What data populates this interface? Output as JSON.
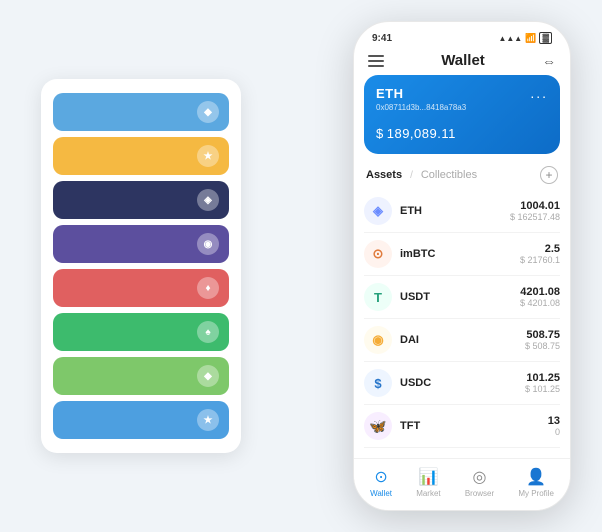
{
  "scene": {
    "background_color": "#f0f4f8"
  },
  "card_stack": {
    "cards": [
      {
        "color": "#5ba8e0",
        "icon": "◆",
        "label": "card-blue"
      },
      {
        "color": "#f5b942",
        "icon": "★",
        "label": "card-yellow"
      },
      {
        "color": "#2d3561",
        "icon": "◈",
        "label": "card-darkblue"
      },
      {
        "color": "#5c4f9e",
        "icon": "◉",
        "label": "card-purple"
      },
      {
        "color": "#e06060",
        "icon": "♦",
        "label": "card-red"
      },
      {
        "color": "#3dbb6d",
        "icon": "♠",
        "label": "card-green"
      },
      {
        "color": "#7ec86a",
        "icon": "◆",
        "label": "card-lightgreen"
      },
      {
        "color": "#4d9fe0",
        "icon": "★",
        "label": "card-lightblue"
      }
    ]
  },
  "phone": {
    "status_bar": {
      "time": "9:41",
      "signal": "▲▲▲",
      "wifi": "wifi",
      "battery": "battery"
    },
    "nav": {
      "title": "Wallet",
      "menu_icon": "menu",
      "expand_icon": "⇔"
    },
    "eth_card": {
      "label": "ETH",
      "address": "0x08711d3b...8418a78a3",
      "balance_symbol": "$",
      "balance": "189,089.11",
      "dots": "..."
    },
    "assets_header": {
      "active_tab": "Assets",
      "divider": "/",
      "inactive_tab": "Collectibles",
      "add_icon": "+"
    },
    "assets": [
      {
        "name": "ETH",
        "icon": "◈",
        "icon_color": "#6b8cff",
        "amount": "1004.01",
        "usd": "$ 162517.48"
      },
      {
        "name": "imBTC",
        "icon": "⊙",
        "icon_color": "#e07b3c",
        "amount": "2.5",
        "usd": "$ 21760.1"
      },
      {
        "name": "USDT",
        "icon": "T",
        "icon_color": "#26a17b",
        "amount": "4201.08",
        "usd": "$ 4201.08"
      },
      {
        "name": "DAI",
        "icon": "◎",
        "icon_color": "#f5ac37",
        "amount": "508.75",
        "usd": "$ 508.75"
      },
      {
        "name": "USDC",
        "icon": "$",
        "icon_color": "#2775ca",
        "amount": "101.25",
        "usd": "$ 101.25"
      },
      {
        "name": "TFT",
        "icon": "🦋",
        "icon_color": "#9b59b6",
        "amount": "13",
        "usd": "0"
      }
    ],
    "bottom_nav": [
      {
        "label": "Wallet",
        "icon": "⊙",
        "active": true
      },
      {
        "label": "Market",
        "icon": "📊",
        "active": false
      },
      {
        "label": "Browser",
        "icon": "◎",
        "active": false
      },
      {
        "label": "My Profile",
        "icon": "👤",
        "active": false
      }
    ]
  }
}
